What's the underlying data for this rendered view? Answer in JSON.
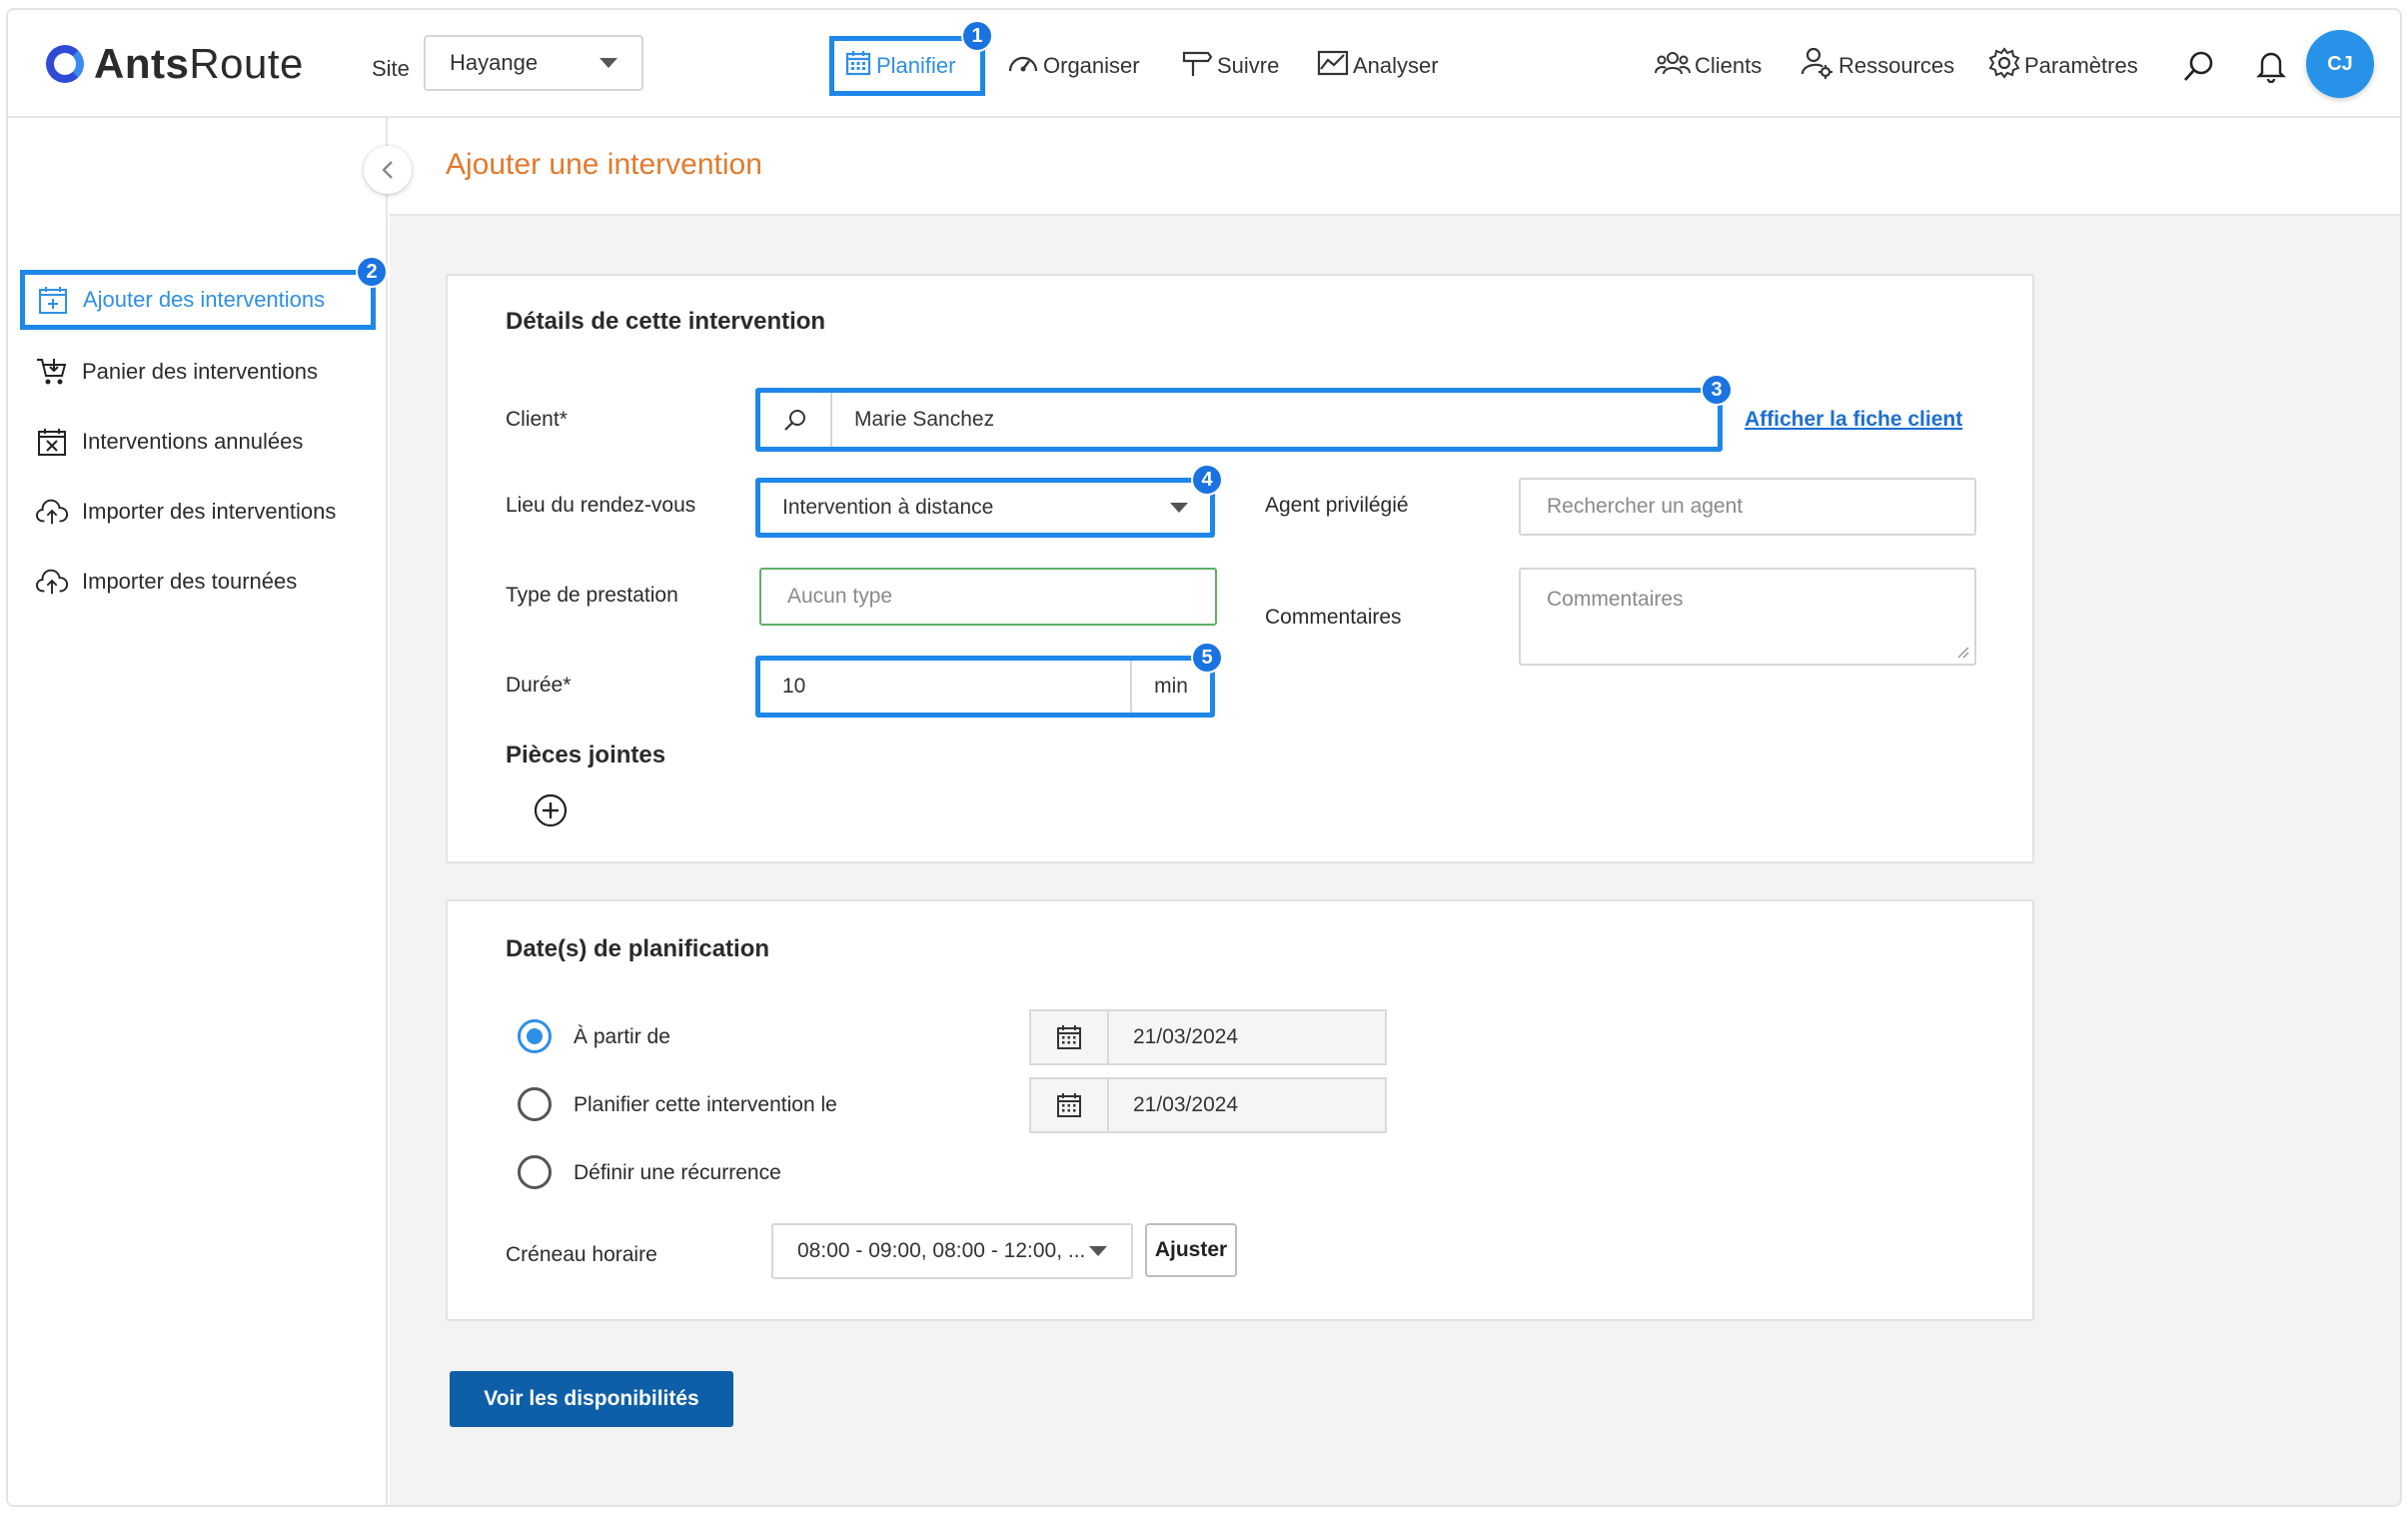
{
  "app": {
    "logo_bold": "Ants",
    "logo_light": "Route"
  },
  "header": {
    "site_label": "Site",
    "site_value": "Hayange",
    "nav": {
      "planifier": "Planifier",
      "organiser": "Organiser",
      "suivre": "Suivre",
      "analyser": "Analyser",
      "clients": "Clients",
      "ressources": "Ressources",
      "parametres": "Paramètres"
    },
    "avatar_initials": "CJ"
  },
  "sidebar": {
    "items": [
      {
        "label": "Ajouter des interventions",
        "icon": "calendar-plus-icon"
      },
      {
        "label": "Panier des interventions",
        "icon": "cart-icon"
      },
      {
        "label": "Interventions annulées",
        "icon": "calendar-x-icon"
      },
      {
        "label": "Importer des interventions",
        "icon": "cloud-upload-icon"
      },
      {
        "label": "Importer des tournées",
        "icon": "cloud-upload-icon"
      }
    ]
  },
  "page": {
    "title": "Ajouter une intervention"
  },
  "details": {
    "title": "Détails de cette intervention",
    "client_label": "Client*",
    "client_value": "Marie Sanchez",
    "client_link": "Afficher la fiche client",
    "lieu_label": "Lieu du rendez-vous",
    "lieu_value": "Intervention à distance",
    "agent_label": "Agent privilégié",
    "agent_placeholder": "Rechercher un agent",
    "type_label": "Type de prestation",
    "type_placeholder": "Aucun type",
    "comment_label": "Commentaires",
    "comment_placeholder": "Commentaires",
    "duree_label": "Durée*",
    "duree_value": "10",
    "duree_unit": "min",
    "pieces_label": "Pièces jointes"
  },
  "planning": {
    "title": "Date(s) de planification",
    "options": [
      {
        "label": "À partir de",
        "selected": true,
        "date": "21/03/2024"
      },
      {
        "label": "Planifier cette intervention le",
        "selected": false,
        "date": "21/03/2024"
      },
      {
        "label": "Définir une récurrence",
        "selected": false
      }
    ],
    "creneau_label": "Créneau horaire",
    "creneau_value": "08:00 - 09:00, 08:00 - 12:00, ...",
    "ajuster": "Ajuster"
  },
  "actions": {
    "voir_disponibilites": "Voir les disponibilités"
  },
  "badges": [
    "1",
    "2",
    "3",
    "4",
    "5"
  ],
  "colors": {
    "accent": "#1f86ea",
    "title_orange": "#e07a2e",
    "primary_button": "#0e5fa8",
    "link": "#1c6fd0"
  }
}
